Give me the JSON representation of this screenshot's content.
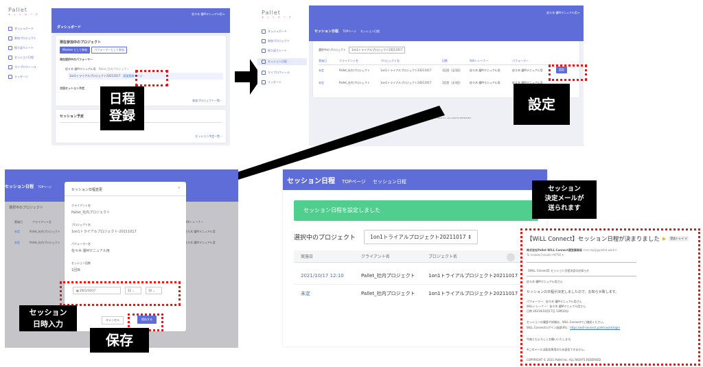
{
  "dashboard": {
    "logo": "Pallet",
    "logo_sub": "ネ ッ ト ワ ー ク",
    "user": "佐々木 優Mマニュアル用 ▾",
    "nav": [
      "ダッシュボード",
      "参加プロジェクト",
      "振り返りシート",
      "セッション日程",
      "マイプロフィール",
      "メッセージ"
    ],
    "title": "ダッシュボード",
    "current_projects": "現在参加中のプロジェクト",
    "tab_client": "Mentee として参加",
    "tab_performer": "パフォーマーとして参加",
    "partner_heading": "現在提供中のパフォーマー",
    "partner_name": "佐々木 優Mマニュアル用",
    "partner_project": "Pallet_社内プロジェクト",
    "project_row": "1on1トライアルプロジェクト20211017",
    "register_link": "面談登録ページ",
    "next_session": "次回セッション予定",
    "joined_link": "参加プロジェクト一覧 ›",
    "schedule_heading": "セッション予定",
    "schedule_link": "セッション予定一覧 ›"
  },
  "callouts": {
    "register": "日程\n登録",
    "settings": "設定",
    "save": "保存",
    "input": "セッション\n日時入力",
    "mail_sent": "セッション\n決定メールが\n送られます"
  },
  "schedule_list": {
    "user": "佐々木 優Mマニュアル用 ▾",
    "title": "セッション日程",
    "crumb_top": "TOPページ",
    "crumb_current": "セッション日程",
    "project_label": "選択中のプロジェクト",
    "project_select": "1on1トライアルプロジェクト20211017",
    "columns": [
      "実施日",
      "クライアント名",
      "プロジェクト名",
      "回数",
      "Willトレーナー",
      "パフォーマー"
    ],
    "rows": [
      {
        "date": "未定",
        "client": "Pallet_社内プロジェクト",
        "project": "1on1トライアルプロジェクト20211017",
        "count": "1回目（全3回）",
        "trainer": "佐々木 優Mマニュアル用",
        "performer": "佐々木 優Mマニュアル用"
      },
      {
        "date": "未定",
        "client": "Pallet_社内プロジェクト",
        "project": "1on1トライアルプロジェクト20211017",
        "count": "1回目（全3回）",
        "trainer": "佐々木 優Mマニュアル用",
        "performer": "佐々木 優Mマニュアル用"
      }
    ],
    "set_button": "設定",
    "footer": "© Pallet Inc. ALL RIGHTS RESERVED."
  },
  "modal": {
    "title": "セッション日程変更",
    "close": "×",
    "client_label": "クライアント名",
    "client_value": "Pallet_社内プロジェクト",
    "project_label": "プロジェクト名",
    "project_value": "1on1トライアルプロジェクト-20211017",
    "performer_label": "パフォーマー名",
    "performer_value": "佐々木 優Mマニュアル用",
    "count_label": "セッション回数",
    "count_value": "1回目",
    "datetime_label": "日時",
    "date_value": "2021/10/17",
    "hour_value": "12",
    "minute_value": "10",
    "cancel": "キャンセル",
    "save": "保存する",
    "bg_title": "セッション日程",
    "bg_crumb": "TOPページ",
    "bg_project_label": "選択中のプロジェクト",
    "bg_columns": [
      "実施日",
      "クライアント名"
    ],
    "bg_rows": [
      [
        "未定",
        "Pallet_社内プロジェクト"
      ],
      [
        "未定",
        "Pallet_社内プロジェクト"
      ]
    ],
    "bg_trainer_col": "Willトレーナー",
    "bg_trainer": "佐々木 優Mマニュアル用"
  },
  "result": {
    "title": "セッション日程",
    "crumb_top": "TOPページ",
    "crumb_current": "セッション日程",
    "alert": "セッション日程を設定しました",
    "project_label": "選択中のプロジェクト",
    "project_select": "1on1トライアルプロジェクト20211017 ⇕",
    "columns": [
      "実施日",
      "クライアント名",
      "プロジェクト名"
    ],
    "rows": [
      {
        "date": "2021/10/17 12:10",
        "client": "Pallet_社内プロジェクト",
        "project": "1on1トライアルプロジェクト20211017"
      },
      {
        "date": "未定",
        "client": "Pallet_社内プロジェクト",
        "project": "1on1トライアルプロジェクト20211017"
      }
    ]
  },
  "email": {
    "subject": "【WiLL Connect】セッション日程が決まりました",
    "label": "受信トレイ ×",
    "from": "株式会社Pallet WiLL Connect運営事務局",
    "from_addr": "<no-reply@pallet.work>",
    "to": "To makoto7sasaki+W792 ▾",
    "heading": "【WiLL Connect】セッション日程決定のお知らせ",
    "greeting": "佐々木 優Mマニュアル用さん",
    "line1": "セッションの日程が決定しましたので、お知らせ致します。",
    "performer": "パフォーマー：佐々木 優Mマニュアル用さん",
    "trainer": "WiLLトレーナー：佐々木 優Mマニュアル用さん",
    "datetime": "日時 2021年10月17日 12時10分",
    "line2": "セッションの履歴や詳細は、WiLL Connectでご確認ください。",
    "login": "WiLL Connectログイン画面URL：",
    "login_url": "https://will-connect.pallet.work/login",
    "line3": "今後ともよろしくお願いいたします。",
    "line4": "※このメールは配信専用のため返信できません。",
    "copyright": "COPYRIGHT © 2021 Pallet Inc. ALL RIGHTS RESERVED."
  },
  "colors": {
    "accent": "#5f6dd9",
    "alert": "#4fce8d",
    "dots": "#e11111",
    "callout": "#000000"
  }
}
